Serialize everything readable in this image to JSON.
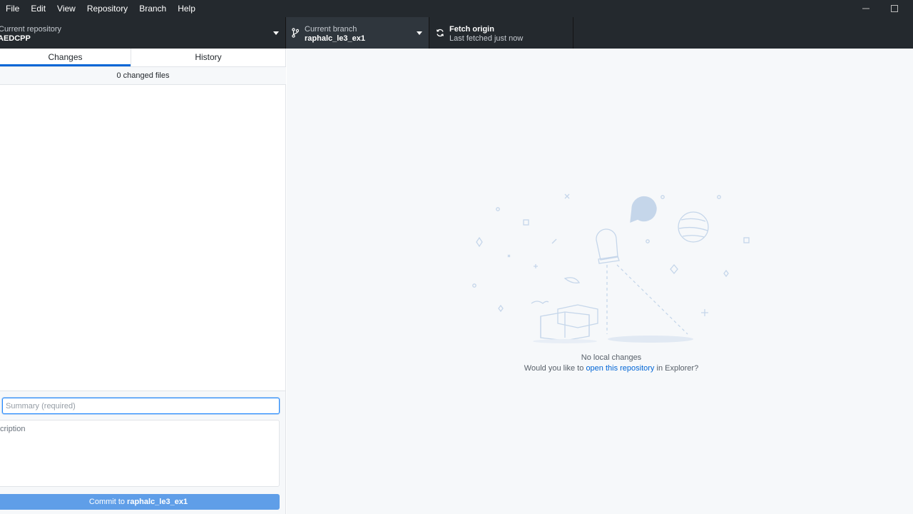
{
  "menu": [
    "File",
    "Edit",
    "View",
    "Repository",
    "Branch",
    "Help"
  ],
  "toolbar": {
    "repo_label": "Current repository",
    "repo_value": "AEDCPP",
    "branch_label": "Current branch",
    "branch_value": "raphalc_le3_ex1",
    "fetch_label": "Fetch origin",
    "fetch_sub": "Last fetched just now"
  },
  "tabs": [
    "Changes",
    "History"
  ],
  "changed_files": "0 changed files",
  "commit": {
    "summary_placeholder": "Summary (required)",
    "description_placeholder": "cription",
    "button_prefix": "Commit to",
    "button_branch": "raphalc_le3_ex1"
  },
  "blank_slate": {
    "title": "No local changes",
    "sub_before": "Would you like to",
    "sub_link": "open this repository",
    "sub_after": "in Explorer?"
  },
  "icons": {
    "minimize": "minimize-icon",
    "maximize": "maximize-icon",
    "branch": "git-branch-icon",
    "sync": "sync-icon",
    "caret": "caret-down-icon"
  },
  "colors": {
    "toolbar_bg": "#24292e",
    "accent": "#0366d6",
    "commit_button": "#5f9ee8",
    "panel_bg": "#f6f8fa"
  }
}
